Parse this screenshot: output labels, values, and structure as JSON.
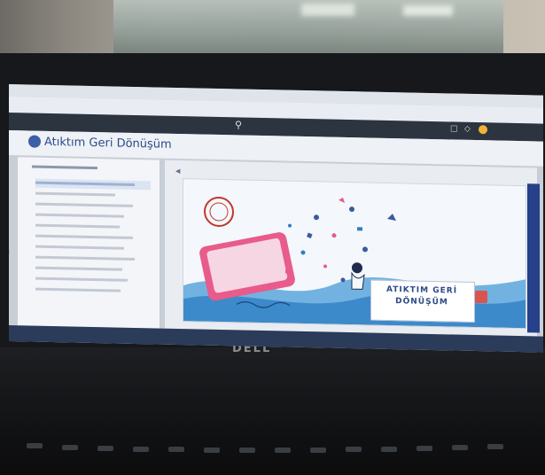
{
  "course": {
    "title": "Atıktım Geri Dönüşüm"
  },
  "site_bar": {
    "left_text": ""
  },
  "address": {
    "text": ""
  },
  "sidebar": {
    "heading": "",
    "items": [
      "",
      "",
      "",
      "",
      "",
      "",
      "",
      "",
      "",
      "",
      ""
    ]
  },
  "banner": {
    "line1": "ATIKTIM GERİ",
    "line2": "DÖNÜŞÜM"
  },
  "user": {
    "name": ""
  },
  "tray": {
    "text": ""
  },
  "laptop": {
    "brand": "DELL"
  },
  "icons": {
    "search": "search-icon",
    "calendar": "calendar-icon",
    "notifications": "bell-icon",
    "course": "course-icon",
    "back": "chevron-left-icon",
    "next": "next-icon"
  },
  "colors": {
    "site_bar": "#2c3440",
    "course_title": "#2d4a8a",
    "scrollbar": "#27408a",
    "taskbar": "#2b3b5a",
    "accent_red": "#d9534f",
    "avatar": "#f2b13a"
  }
}
